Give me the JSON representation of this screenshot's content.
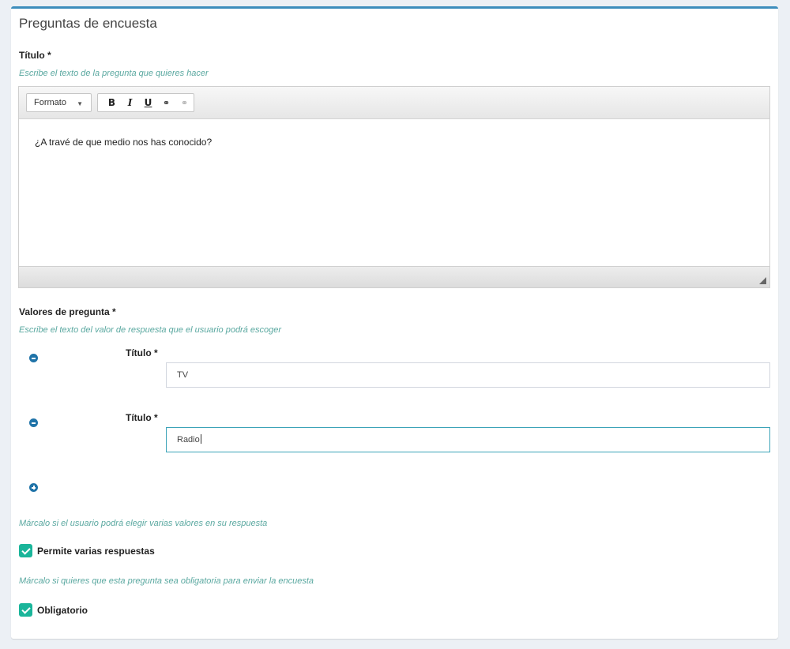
{
  "panel": {
    "title": "Preguntas de encuesta"
  },
  "question": {
    "label": "Título *",
    "help": "Escribe el texto de la pregunta que quieres hacer",
    "editor": {
      "toolbar": {
        "format_label": "Formato",
        "bold": "B",
        "italic": "I",
        "underline": "U",
        "link": "⚭",
        "unlink": "⚭"
      },
      "content": "¿A travé de que medio nos has conocido?"
    }
  },
  "values": {
    "label": "Valores de pregunta *",
    "help": "Escribe el texto del valor de respuesta que el usuario podrá escoger",
    "items": [
      {
        "label": "Título *",
        "value": "TV"
      },
      {
        "label": "Título *",
        "value": "Radio"
      }
    ]
  },
  "multiple": {
    "help": "Márcalo si el usuario podrá elegir varias valores en su respuesta",
    "label": "Permite varias respuestas",
    "checked": true
  },
  "required": {
    "help": "Márcalo si quieres que esta pregunta sea obligatoria para enviar la encuesta",
    "label": "Obligatorio",
    "checked": true
  },
  "colors": {
    "accent": "#3c8dbc",
    "help_text": "#5aa8a0",
    "checkbox": "#1ab59a",
    "round_button": "#1f73a8"
  }
}
